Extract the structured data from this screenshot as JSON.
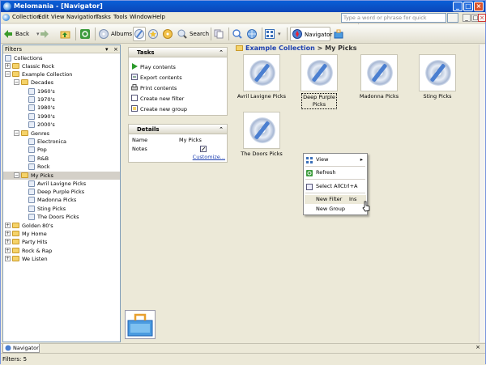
{
  "window": {
    "title": "Melomania - [Navigator]"
  },
  "menus": [
    "Collection",
    "Edit",
    "View",
    "Navigation",
    "Tasks",
    "Tools",
    "Window",
    "Help"
  ],
  "quick_search": {
    "placeholder": "Type a word or phrase for quick search"
  },
  "toolbar": {
    "back": "Back",
    "albums": "Albums",
    "search": "Search",
    "navigator": "Navigator"
  },
  "filters": {
    "title": "Filters",
    "tree": [
      {
        "label": "Collections",
        "level": 0,
        "kind": "note"
      },
      {
        "label": "Classic Rock",
        "level": 0,
        "kind": "folder"
      },
      {
        "label": "Example Collection",
        "level": 0,
        "kind": "folder"
      },
      {
        "label": "Decades",
        "level": 1,
        "kind": "group"
      },
      {
        "label": "1960's",
        "level": 2,
        "kind": "note"
      },
      {
        "label": "1970's",
        "level": 2,
        "kind": "note"
      },
      {
        "label": "1980's",
        "level": 2,
        "kind": "note"
      },
      {
        "label": "1990's",
        "level": 2,
        "kind": "note"
      },
      {
        "label": "2000's",
        "level": 2,
        "kind": "note"
      },
      {
        "label": "Genres",
        "level": 1,
        "kind": "group"
      },
      {
        "label": "Electronica",
        "level": 2,
        "kind": "note"
      },
      {
        "label": "Pop",
        "level": 2,
        "kind": "note"
      },
      {
        "label": "R&B",
        "level": 2,
        "kind": "note"
      },
      {
        "label": "Rock",
        "level": 2,
        "kind": "note"
      },
      {
        "label": "My Picks",
        "level": 1,
        "kind": "group",
        "selected": true
      },
      {
        "label": "Avril Lavigne Picks",
        "level": 2,
        "kind": "note"
      },
      {
        "label": "Deep Purple Picks",
        "level": 2,
        "kind": "note"
      },
      {
        "label": "Madonna Picks",
        "level": 2,
        "kind": "note"
      },
      {
        "label": "Sting Picks",
        "level": 2,
        "kind": "note"
      },
      {
        "label": "The Doors Picks",
        "level": 2,
        "kind": "note"
      },
      {
        "label": "Golden 80's",
        "level": 0,
        "kind": "folder"
      },
      {
        "label": "My Home",
        "level": 0,
        "kind": "folder"
      },
      {
        "label": "Party Hits",
        "level": 0,
        "kind": "folder"
      },
      {
        "label": "Rock & Rap",
        "level": 0,
        "kind": "folder"
      },
      {
        "label": "We Listen",
        "level": 0,
        "kind": "folder"
      }
    ]
  },
  "tasks": {
    "title": "Tasks",
    "items": [
      "Play contents",
      "Export contents",
      "Print contents",
      "Create new filter",
      "Create new group"
    ]
  },
  "details": {
    "title": "Details",
    "name_label": "Name",
    "name_value": "My Picks",
    "notes_label": "Notes",
    "customize": "Customize..."
  },
  "breadcrumb": {
    "parent": "Example Collection",
    "sep": ">",
    "current": "My Picks"
  },
  "items": [
    "Avril Lavigne Picks",
    "Deep Purple Picks",
    "Madonna Picks",
    "Sting Picks",
    "The Doors Picks"
  ],
  "context_menu": {
    "view": "View",
    "refresh": "Refresh",
    "select_all": "Select All",
    "select_all_shortcut": "Ctrl+A",
    "new_filter": "New Filter",
    "new_filter_shortcut": "Ins",
    "new_group": "New Group"
  },
  "tab": {
    "label": "Navigator"
  },
  "status": {
    "text": "Filters: 5"
  }
}
